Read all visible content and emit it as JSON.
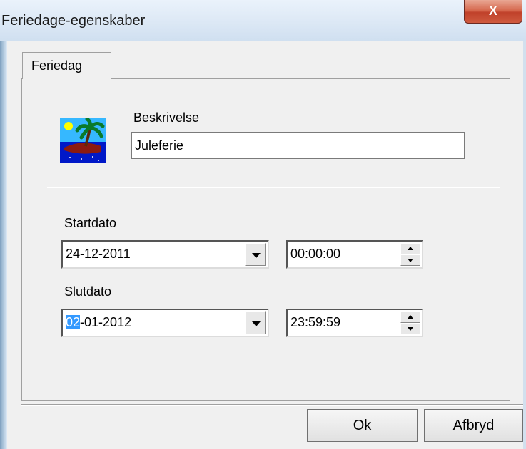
{
  "window": {
    "title": "Feriedage-egenskaber",
    "close_glyph": "X"
  },
  "tabs": [
    {
      "label": "Feriedag",
      "active": true
    }
  ],
  "icon": {
    "name": "beach-palm-icon"
  },
  "description": {
    "label": "Beskrivelse",
    "value": "Juleferie"
  },
  "start": {
    "label": "Startdato",
    "date": "24-12-2011",
    "time": "00:00:00"
  },
  "end": {
    "label": "Slutdato",
    "date_selected": "02",
    "date_rest": "-01-2012",
    "time": "23:59:59"
  },
  "buttons": {
    "ok": "Ok",
    "cancel": "Afbryd"
  },
  "colors": {
    "selection": "#3399ff",
    "close_button": "#c0412a"
  }
}
